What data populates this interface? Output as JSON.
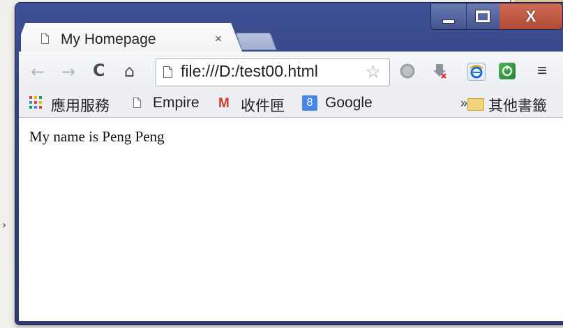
{
  "tab": {
    "title": "My Homepage",
    "close": "×"
  },
  "window_controls": {
    "close": "X"
  },
  "toolbar": {
    "back": "←",
    "forward": "→",
    "reload": "C",
    "home": "⌂",
    "url": "file:///D:/test00.html",
    "star": "☆",
    "menu": "≡"
  },
  "bookmarks": {
    "apps": "應用服務",
    "empire": "Empire",
    "gmail_icon": "M",
    "inbox": "收件匣",
    "google_icon": "8",
    "google": "Google",
    "more": "»",
    "other": "其他書籤"
  },
  "page": {
    "text": "My name is Peng Peng"
  },
  "colors": {
    "frame": "#33437f",
    "close_button": "#c0543f",
    "page_background": "#ffffff"
  }
}
